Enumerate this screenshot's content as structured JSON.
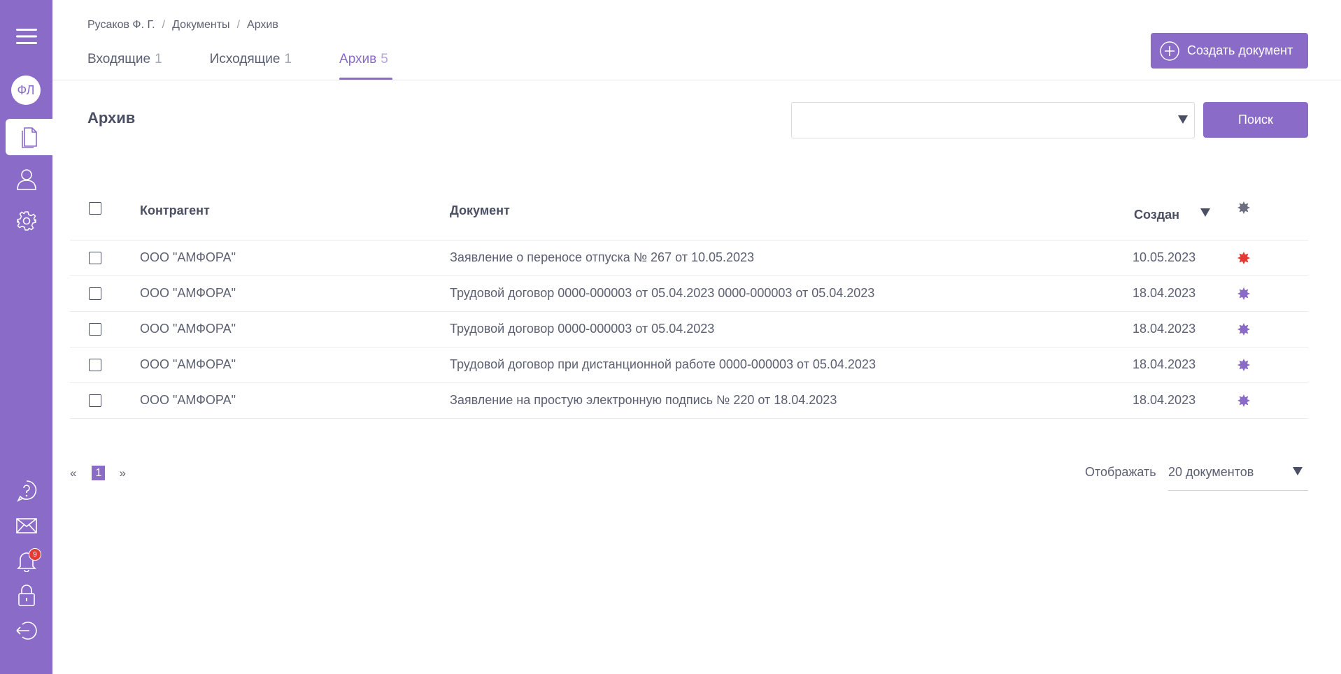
{
  "sidebar": {
    "avatar_initials": "ФЛ",
    "notification_count": "9",
    "icons": [
      "menu-icon",
      "documents-icon",
      "contacts-icon",
      "settings-icon",
      "help-icon",
      "mail-icon",
      "bell-icon",
      "lock-icon",
      "logout-icon"
    ]
  },
  "breadcrumb": {
    "items": [
      "Русаков Ф. Г.",
      "Документы",
      "Архив"
    ],
    "separator": "/"
  },
  "tabs": [
    {
      "label": "Входящие",
      "count": "1"
    },
    {
      "label": "Исходящие",
      "count": "1"
    },
    {
      "label": "Архив",
      "count": "5"
    }
  ],
  "header": {
    "create_label": "Создать документ"
  },
  "section": {
    "title": "Архив",
    "search_label": "Поиск",
    "filter_value": ""
  },
  "table": {
    "columns": {
      "counterparty": "Контрагент",
      "document": "Документ",
      "created": "Создан"
    },
    "rows": [
      {
        "counterparty": "ООО \"АМФОРА\"",
        "document": "Заявление о переносе отпуска № 267 от 10.05.2023",
        "created": "10.05.2023",
        "status_color": "#e53935"
      },
      {
        "counterparty": "ООО \"АМФОРА\"",
        "document": "Трудовой договор 0000-000003 от 05.04.2023 0000-000003 от 05.04.2023",
        "created": "18.04.2023",
        "status_color": "#8b6bc8"
      },
      {
        "counterparty": "ООО \"АМФОРА\"",
        "document": "Трудовой договор 0000-000003 от 05.04.2023",
        "created": "18.04.2023",
        "status_color": "#8b6bc8"
      },
      {
        "counterparty": "ООО \"АМФОРА\"",
        "document": "Трудовой договор при дистанционной работе 0000-000003 от 05.04.2023",
        "created": "18.04.2023",
        "status_color": "#8b6bc8"
      },
      {
        "counterparty": "ООО \"АМФОРА\"",
        "document": "Заявление на простую электронную подпись № 220 от 18.04.2023",
        "created": "18.04.2023",
        "status_color": "#8b6bc8"
      }
    ]
  },
  "pagination": {
    "prev": "«",
    "current": "1",
    "next": "»"
  },
  "per_page": {
    "label": "Отображать",
    "value": "20 документов"
  },
  "colors": {
    "accent": "#8b6bc8",
    "status_header": "#6b6f80"
  }
}
